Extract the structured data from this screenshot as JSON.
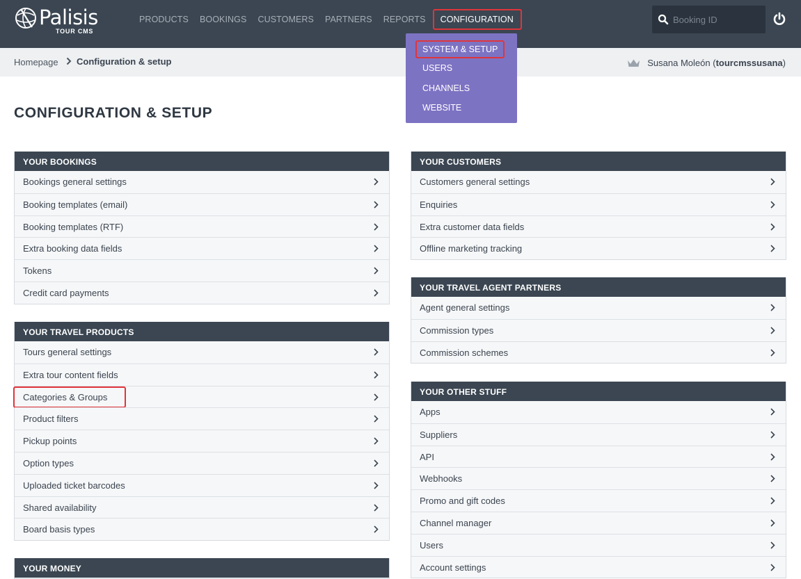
{
  "app": {
    "brand": "Palisis",
    "product": "TOUR CMS"
  },
  "nav": {
    "items": [
      {
        "label": "PRODUCTS"
      },
      {
        "label": "BOOKINGS"
      },
      {
        "label": "CUSTOMERS"
      },
      {
        "label": "PARTNERS"
      },
      {
        "label": "REPORTS"
      },
      {
        "label": "CONFIGURATION",
        "active": true
      }
    ]
  },
  "search": {
    "placeholder": "Booking ID",
    "icon": "search-icon"
  },
  "power_icon": "power-icon",
  "dropdown": {
    "items": [
      {
        "label": "SYSTEM & SETUP",
        "highlight": true
      },
      {
        "label": "USERS"
      },
      {
        "label": "CHANNELS"
      },
      {
        "label": "WEBSITE"
      }
    ]
  },
  "breadcrumb": {
    "home": "Homepage",
    "current": "Configuration & setup"
  },
  "user": {
    "name": "Susana Moleón",
    "login": "tourcmssusana",
    "open_paren": "(",
    "close_paren": ")"
  },
  "page_title": "CONFIGURATION & SETUP",
  "panels": {
    "bookings": {
      "title": "YOUR BOOKINGS",
      "items": [
        "Bookings general settings",
        "Booking templates (email)",
        "Booking templates (RTF)",
        "Extra booking data fields",
        "Tokens",
        "Credit card payments"
      ]
    },
    "products": {
      "title": "YOUR TRAVEL PRODUCTS",
      "items": [
        "Tours general settings",
        "Extra tour content fields",
        "Categories & Groups",
        "Product filters",
        "Pickup points",
        "Option types",
        "Uploaded ticket barcodes",
        "Shared availability",
        "Board basis types"
      ]
    },
    "money": {
      "title": "YOUR MONEY",
      "items": []
    },
    "customers": {
      "title": "YOUR CUSTOMERS",
      "items": [
        "Customers general settings",
        "Enquiries",
        "Extra customer data fields",
        "Offline marketing tracking"
      ]
    },
    "agents": {
      "title": "YOUR TRAVEL AGENT PARTNERS",
      "items": [
        "Agent general settings",
        "Commission types",
        "Commission schemes"
      ]
    },
    "other": {
      "title": "YOUR OTHER STUFF",
      "items": [
        "Apps",
        "Suppliers",
        "API",
        "Webhooks",
        "Promo and gift codes",
        "Channel manager",
        "Users",
        "Account settings"
      ]
    }
  },
  "colors": {
    "header_bg": "#3b4652",
    "dropdown_bg": "#7d73c3",
    "highlight_red": "#e0353b",
    "crumb_bg": "#eef0f2"
  }
}
